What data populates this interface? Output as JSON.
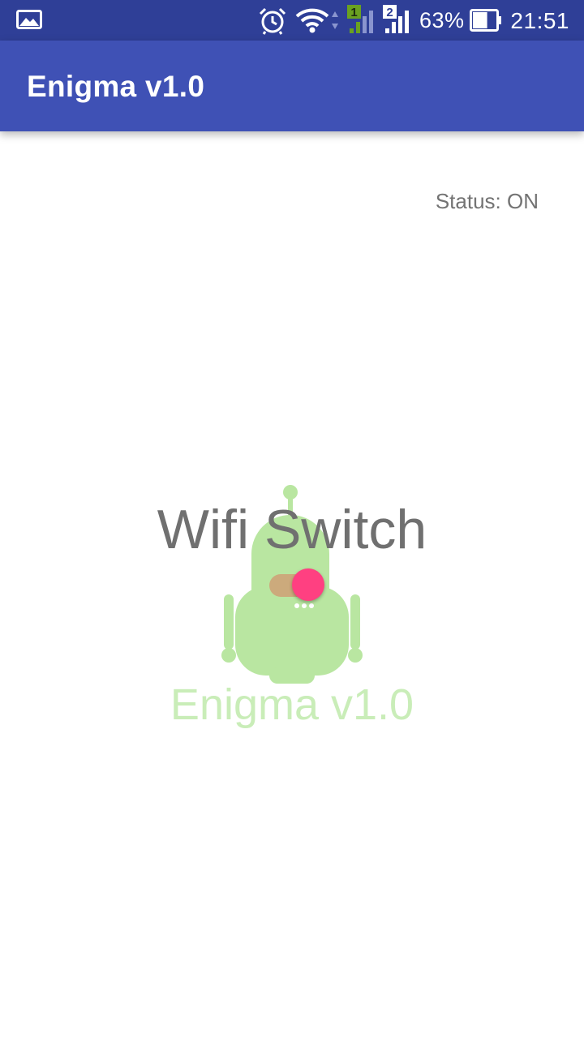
{
  "status_bar": {
    "notification_icon": "image-icon",
    "alarm_icon": "alarm-icon",
    "wifi_icon": "wifi-icon",
    "sim1_label": "1",
    "sim2_label": "2",
    "battery_percent": "63%",
    "battery_level": 0.63,
    "time": "21:51"
  },
  "app_bar": {
    "title": "Enigma v1.0"
  },
  "main": {
    "status": "Status: ON",
    "heading": "Wifi Switch",
    "switch_on": true,
    "logo_text": "Enigma v1.0"
  },
  "colors": {
    "status_bar": "#2f3f97",
    "app_bar": "#3f51b5",
    "accent": "#ff4081",
    "logo_green": "#b8e6a0"
  }
}
